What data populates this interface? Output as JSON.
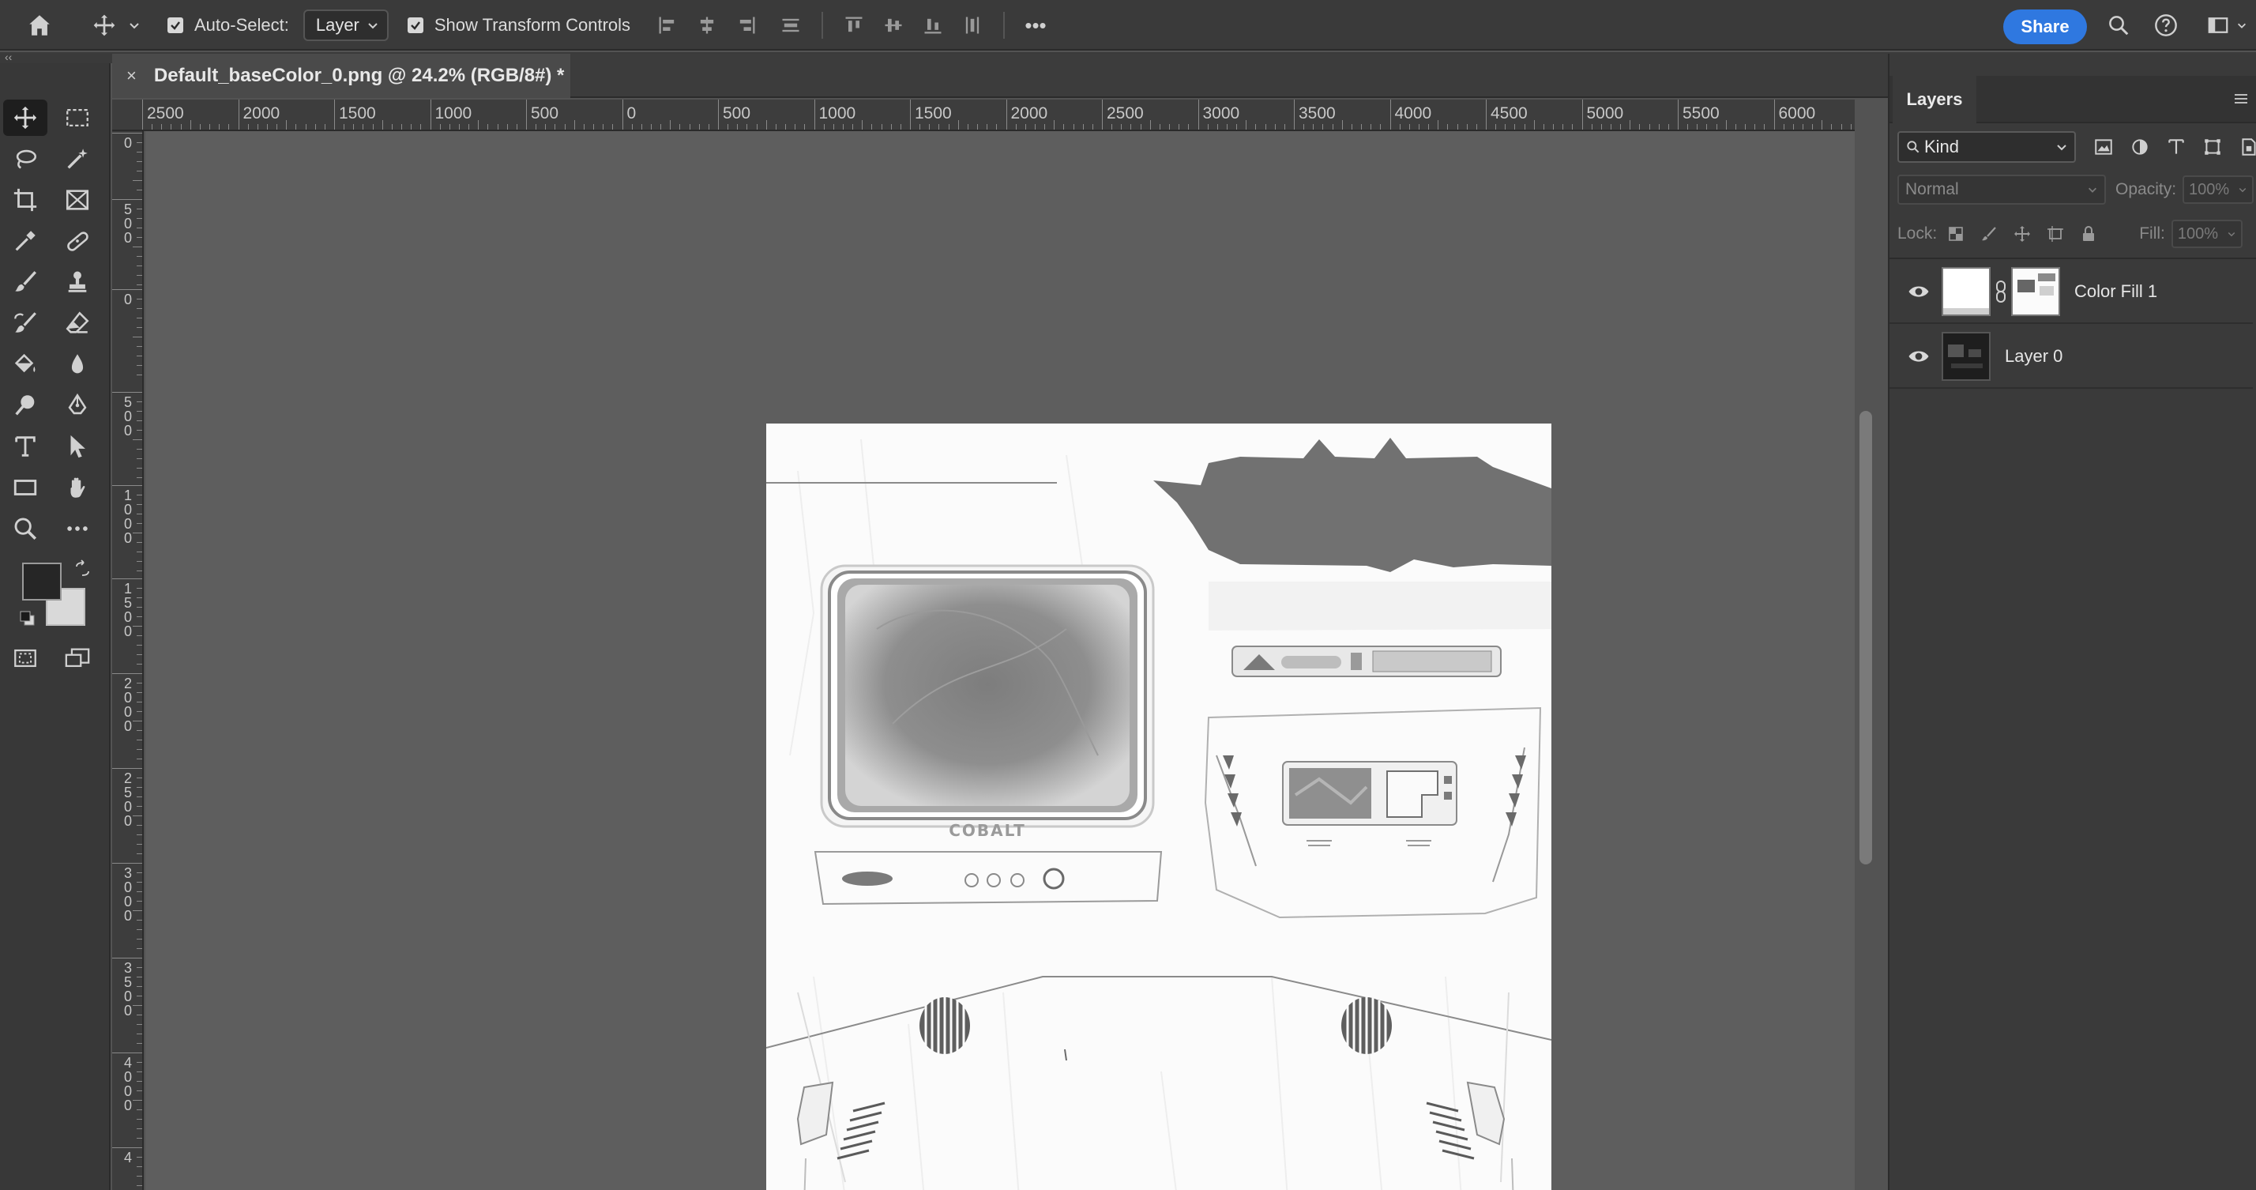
{
  "options_bar": {
    "auto_select_label": "Auto-Select:",
    "auto_select_checked": true,
    "auto_select_value": "Layer",
    "show_transform_label": "Show Transform Controls",
    "show_transform_checked": true,
    "share_label": "Share",
    "more_label": "•••"
  },
  "collapse": {
    "left": "‹‹",
    "right": "››"
  },
  "document": {
    "tab_title": "Default_baseColor_0.png @ 24.2% (RGB/8#) *",
    "close_glyph": "×"
  },
  "rulers": {
    "top": [
      "2500",
      "2000",
      "1500",
      "1000",
      "500",
      "0",
      "500",
      "1000",
      "1500",
      "2000",
      "2500",
      "3000",
      "3500",
      "4000",
      "4500",
      "5000",
      "5500",
      "6000"
    ],
    "left": [
      "0",
      "500",
      "0",
      "500",
      "1000",
      "1500",
      "2000",
      "2500",
      "3000",
      "3500",
      "4000",
      "4"
    ]
  },
  "artwork": {
    "brand_text": "COBALT"
  },
  "colors": {
    "accent": "#2f78e0",
    "foreground_swatch": "#262626",
    "background_swatch": "#d9d9d9",
    "canvas_bg": "#5e5e5e",
    "panel_bg": "#3a3a3a"
  },
  "layers_panel": {
    "tab_label": "Layers",
    "filter_kind": "Kind",
    "blend_mode": "Normal",
    "opacity_label": "Opacity:",
    "opacity_value": "100%",
    "lock_label": "Lock:",
    "fill_label": "Fill:",
    "fill_value": "100%",
    "layers": [
      {
        "name": "Color Fill 1",
        "visible": true,
        "has_mask": true
      },
      {
        "name": "Layer 0",
        "visible": true,
        "has_mask": false
      }
    ]
  }
}
